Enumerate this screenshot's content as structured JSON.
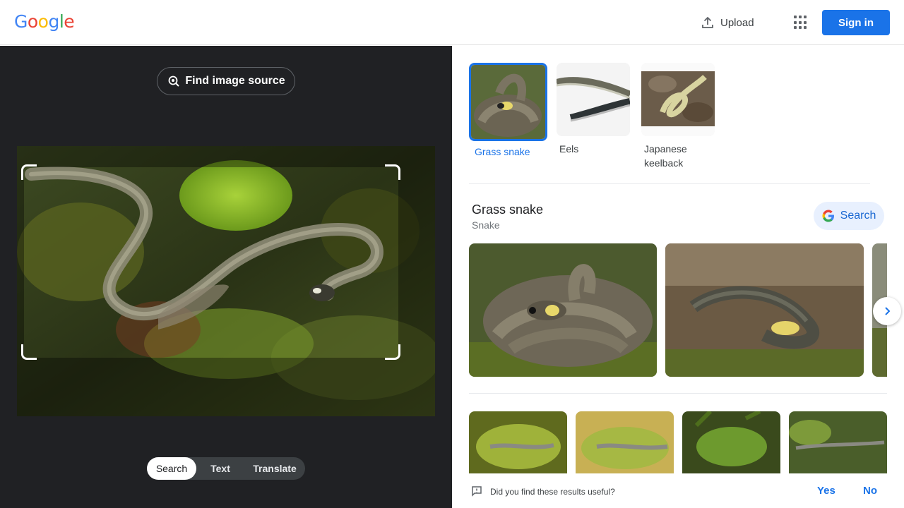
{
  "header": {
    "logo_letters": [
      "G",
      "o",
      "o",
      "g",
      "l",
      "e"
    ],
    "logo_colors": [
      "#4285f4",
      "#ea4335",
      "#fbbc05",
      "#4285f4",
      "#34a853",
      "#ea4335"
    ],
    "upload_label": "Upload",
    "signin_label": "Sign in"
  },
  "left_panel": {
    "find_source_label": "Find image source",
    "tabs": [
      {
        "label": "Search",
        "active": true
      },
      {
        "label": "Text",
        "active": false
      },
      {
        "label": "Translate",
        "active": false
      }
    ]
  },
  "matches": [
    {
      "label": "Grass snake",
      "selected": true
    },
    {
      "label": "Eels",
      "selected": false
    },
    {
      "label": "Japanese keelback",
      "selected": false
    }
  ],
  "entity": {
    "title": "Grass snake",
    "subtitle": "Snake",
    "search_label": "Search"
  },
  "feedback": {
    "question": "Did you find these results useful?",
    "yes": "Yes",
    "no": "No"
  },
  "colors": {
    "accent": "#1a73e8",
    "dark_panel": "#202124"
  }
}
